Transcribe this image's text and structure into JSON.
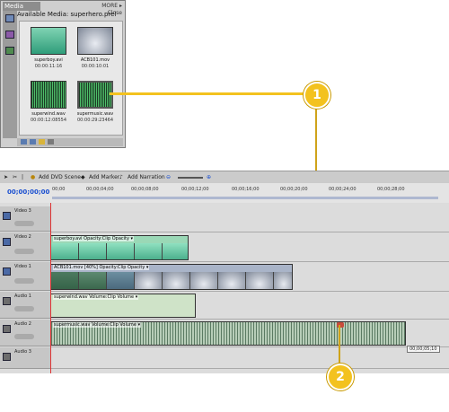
{
  "media": {
    "tab_label": "Media",
    "more_label": "MORE ▸",
    "header_label": "Available Media: superhero.prel",
    "close_label": "Close",
    "items": [
      {
        "name": "superboy.avi",
        "duration": "00:00:11:16"
      },
      {
        "name": "ACB101.mov",
        "duration": "00:00:10:01"
      },
      {
        "name": "superwind.wav",
        "duration": "00:00:12:08554"
      },
      {
        "name": "supermusic.wav",
        "duration": "00:00:29:23464"
      }
    ]
  },
  "callouts": {
    "one": "1",
    "two": "2"
  },
  "toolbar": {
    "add_dvd_scene": "Add DVD Scene",
    "add_marker": "Add Marker",
    "add_narration": "Add Narration"
  },
  "ruler": {
    "timecode": "00;00;00;00",
    "ticks": [
      "00;00",
      "00;00;04;00",
      "00;00;08;00",
      "00;00;12;00",
      "00;00;16;00",
      "00;00;20;00",
      "00;00;24;00",
      "00;00;28;00"
    ]
  },
  "tracks": [
    {
      "name": "Video 3"
    },
    {
      "name": "Video 2"
    },
    {
      "name": "Video 1"
    },
    {
      "name": "Audio 1"
    },
    {
      "name": "Audio 2"
    },
    {
      "name": "Audio 3"
    }
  ],
  "clips": {
    "video2": "superboy.avi Opacity:Clip Opacity ▾",
    "video1": "ACB101.mov [40%] Opacity:Clip Opacity ▾",
    "audio1": "superwind.wav Volume:Clip Volume ▾",
    "audio2": "supermusic.wav Volume:Clip Volume ▾"
  },
  "timecode_badge": "00;00;05;10",
  "colors": {
    "callout": "#f3c21f",
    "timecode": "#1a4fd0",
    "playhead": "#dd3333"
  }
}
